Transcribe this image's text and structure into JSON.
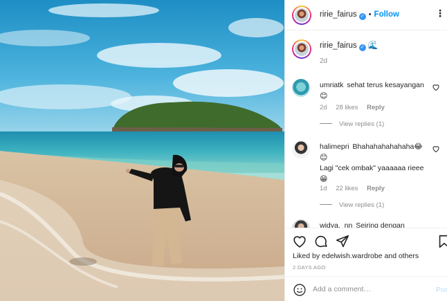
{
  "post": {
    "username": "ririe_fairus",
    "follow_label": "Follow",
    "dot": "•",
    "more_label": "⋮",
    "caption_emoji": "🌊",
    "caption_age": "2d"
  },
  "comments": [
    {
      "username": "umriatk",
      "text": "sehat terus kesayangan",
      "emoji": "😊",
      "age": "2d",
      "likes": "28 likes",
      "reply": "Reply",
      "view_replies": "View replies (1)"
    },
    {
      "username": "halimepri",
      "text": "Bhahahahahahaha😂",
      "emoji2": "😊",
      "text2": "Lagi \"cek ombak\" yaaaaaa rieee",
      "emoji3": "😁",
      "age": "1d",
      "likes": "22 likes",
      "reply": "Reply",
      "view_replies": "View replies (1)"
    },
    {
      "username": "widya._nn",
      "text": "Seiring dengan"
    }
  ],
  "actions": {
    "liked_prefix": "Liked by",
    "liked_user": "edelwish.wardrobe",
    "liked_suffix": "and others",
    "date": "2 DAYS AGO"
  },
  "add_comment": {
    "placeholder": "Add a comment…",
    "post_label": "Post"
  },
  "colors": {
    "accent_blue": "#0095f6",
    "verified_blue": "#3897f0",
    "muted_text": "#8e8e8e",
    "border": "#efefef"
  },
  "icons": [
    "verified-badge-icon",
    "more-options-icon",
    "heart-icon",
    "comment-icon",
    "share-icon",
    "bookmark-icon",
    "emoji-icon"
  ]
}
